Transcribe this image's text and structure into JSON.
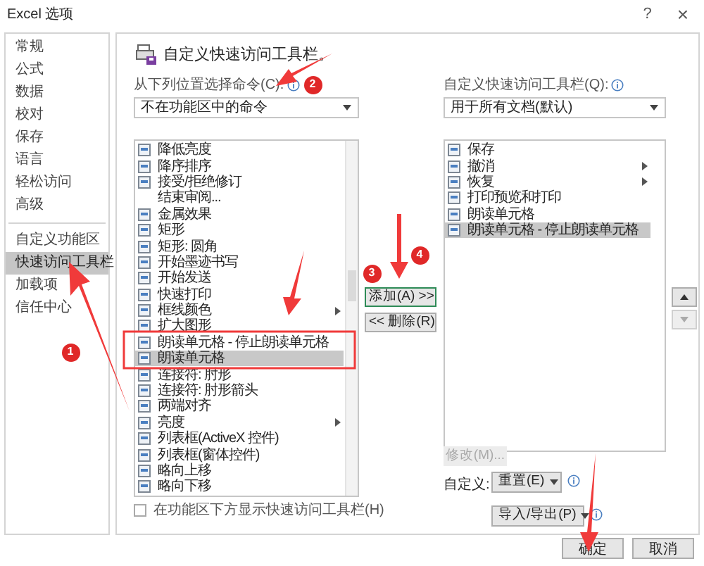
{
  "window": {
    "title": "Excel 选项",
    "help": "?",
    "close": "×"
  },
  "sidebar": {
    "items": [
      {
        "label": "常规",
        "selected": false
      },
      {
        "label": "公式",
        "selected": false
      },
      {
        "label": "数据",
        "selected": false
      },
      {
        "label": "校对",
        "selected": false
      },
      {
        "label": "保存",
        "selected": false
      },
      {
        "label": "语言",
        "selected": false
      },
      {
        "label": "轻松访问",
        "selected": false
      },
      {
        "label": "高级",
        "selected": false
      },
      {
        "label": "自定义功能区",
        "selected": false,
        "separator_before": true
      },
      {
        "label": "快速访问工具栏",
        "selected": true
      },
      {
        "label": "加载项",
        "selected": false
      },
      {
        "label": "信任中心",
        "selected": false
      }
    ]
  },
  "header": "自定义快速访问工具栏。",
  "source": {
    "label": "从下列位置选择命令(C):",
    "dropdown": "不在功能区中的命令",
    "commands": [
      {
        "label": "降低亮度",
        "selected": false,
        "submenu": false
      },
      {
        "label": "降序排序",
        "selected": false,
        "submenu": false
      },
      {
        "label": "接受/拒绝修订",
        "selected": false,
        "submenu": false
      },
      {
        "label": "结束审阅...",
        "selected": false,
        "submenu": false,
        "no_icon": true
      },
      {
        "label": "金属效果",
        "selected": false,
        "submenu": false
      },
      {
        "label": "矩形",
        "selected": false,
        "submenu": false
      },
      {
        "label": "矩形: 圆角",
        "selected": false,
        "submenu": false
      },
      {
        "label": "开始墨迹书写",
        "selected": false,
        "submenu": false
      },
      {
        "label": "开始发送",
        "selected": false,
        "submenu": false
      },
      {
        "label": "快速打印",
        "selected": false,
        "submenu": false
      },
      {
        "label": "框线颜色",
        "selected": false,
        "submenu": true
      },
      {
        "label": "扩大图形",
        "selected": false,
        "submenu": false
      },
      {
        "label": "朗读单元格 - 停止朗读单元格",
        "selected": false,
        "submenu": false
      },
      {
        "label": "朗读单元格",
        "selected": true,
        "submenu": false
      },
      {
        "label": "连接符: 肘形",
        "selected": false,
        "submenu": false
      },
      {
        "label": "连接符: 肘形箭头",
        "selected": false,
        "submenu": false
      },
      {
        "label": "两端对齐",
        "selected": false,
        "submenu": false
      },
      {
        "label": "亮度",
        "selected": false,
        "submenu": true
      },
      {
        "label": "列表框(ActiveX 控件)",
        "selected": false,
        "submenu": false
      },
      {
        "label": "列表框(窗体控件)",
        "selected": false,
        "submenu": false
      },
      {
        "label": "略向上移",
        "selected": false,
        "submenu": false
      },
      {
        "label": "略向下移",
        "selected": false,
        "submenu": false
      }
    ],
    "checkbox": {
      "label": "在功能区下方显示快速访问工具栏(H)",
      "checked": false
    }
  },
  "buttons": {
    "add": "添加(A) >>",
    "remove": "<< 删除(R)",
    "modify": "修改(M)...",
    "ok": "确定",
    "cancel": "取消"
  },
  "target": {
    "label": "自定义快速访问工具栏(Q):",
    "dropdown": "用于所有文档(默认)",
    "commands": [
      {
        "label": "保存",
        "selected": false,
        "submenu": false
      },
      {
        "label": "撤消",
        "selected": false,
        "submenu": true
      },
      {
        "label": "恢复",
        "selected": false,
        "submenu": true
      },
      {
        "label": "打印预览和打印",
        "selected": false,
        "submenu": false
      },
      {
        "label": "朗读单元格",
        "selected": false,
        "submenu": false
      },
      {
        "label": "朗读单元格 - 停止朗读单元格",
        "selected": true,
        "submenu": false
      }
    ]
  },
  "customize": {
    "label": "自定义:",
    "reset": "重置(E)",
    "import_export": "导入/导出(P)"
  },
  "annotations": [
    "1",
    "2",
    "3",
    "4"
  ]
}
